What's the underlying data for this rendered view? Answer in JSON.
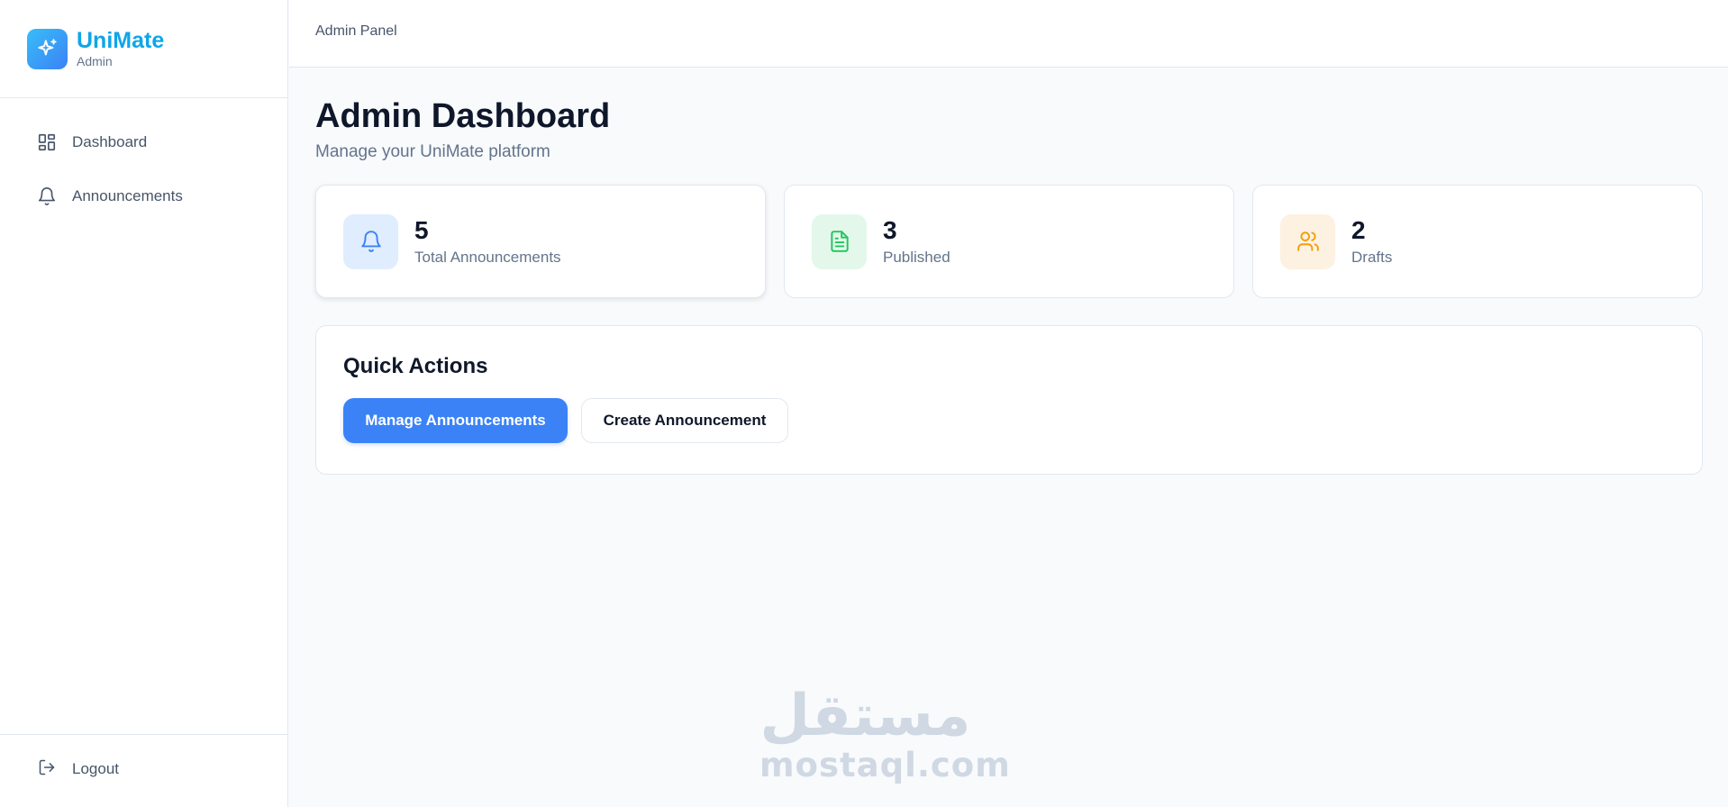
{
  "brand": {
    "name": "UniMate",
    "subtitle": "Admin"
  },
  "sidebar": {
    "items": [
      {
        "label": "Dashboard",
        "icon": "layout-grid-icon"
      },
      {
        "label": "Announcements",
        "icon": "bell-icon"
      }
    ],
    "logout_label": "Logout"
  },
  "topbar": {
    "title": "Admin Panel"
  },
  "page": {
    "title": "Admin Dashboard",
    "subtitle": "Manage your UniMate platform"
  },
  "stats": [
    {
      "value": "5",
      "label": "Total Announcements",
      "icon": "bell-icon",
      "color": "#3b82f6",
      "bg": "#e0edff"
    },
    {
      "value": "3",
      "label": "Published",
      "icon": "file-text-icon",
      "color": "#22c55e",
      "bg": "#e3f8ea"
    },
    {
      "value": "2",
      "label": "Drafts",
      "icon": "users-icon",
      "color": "#f59e0b",
      "bg": "#fdf1e1"
    }
  ],
  "quick_actions": {
    "title": "Quick Actions",
    "primary_label": "Manage Announcements",
    "secondary_label": "Create Announcement"
  },
  "watermark": {
    "arabic": "مستقل",
    "latin": "mostaql.com"
  },
  "colors": {
    "accent": "#3b82f6",
    "brand": "#0ea5e9"
  }
}
